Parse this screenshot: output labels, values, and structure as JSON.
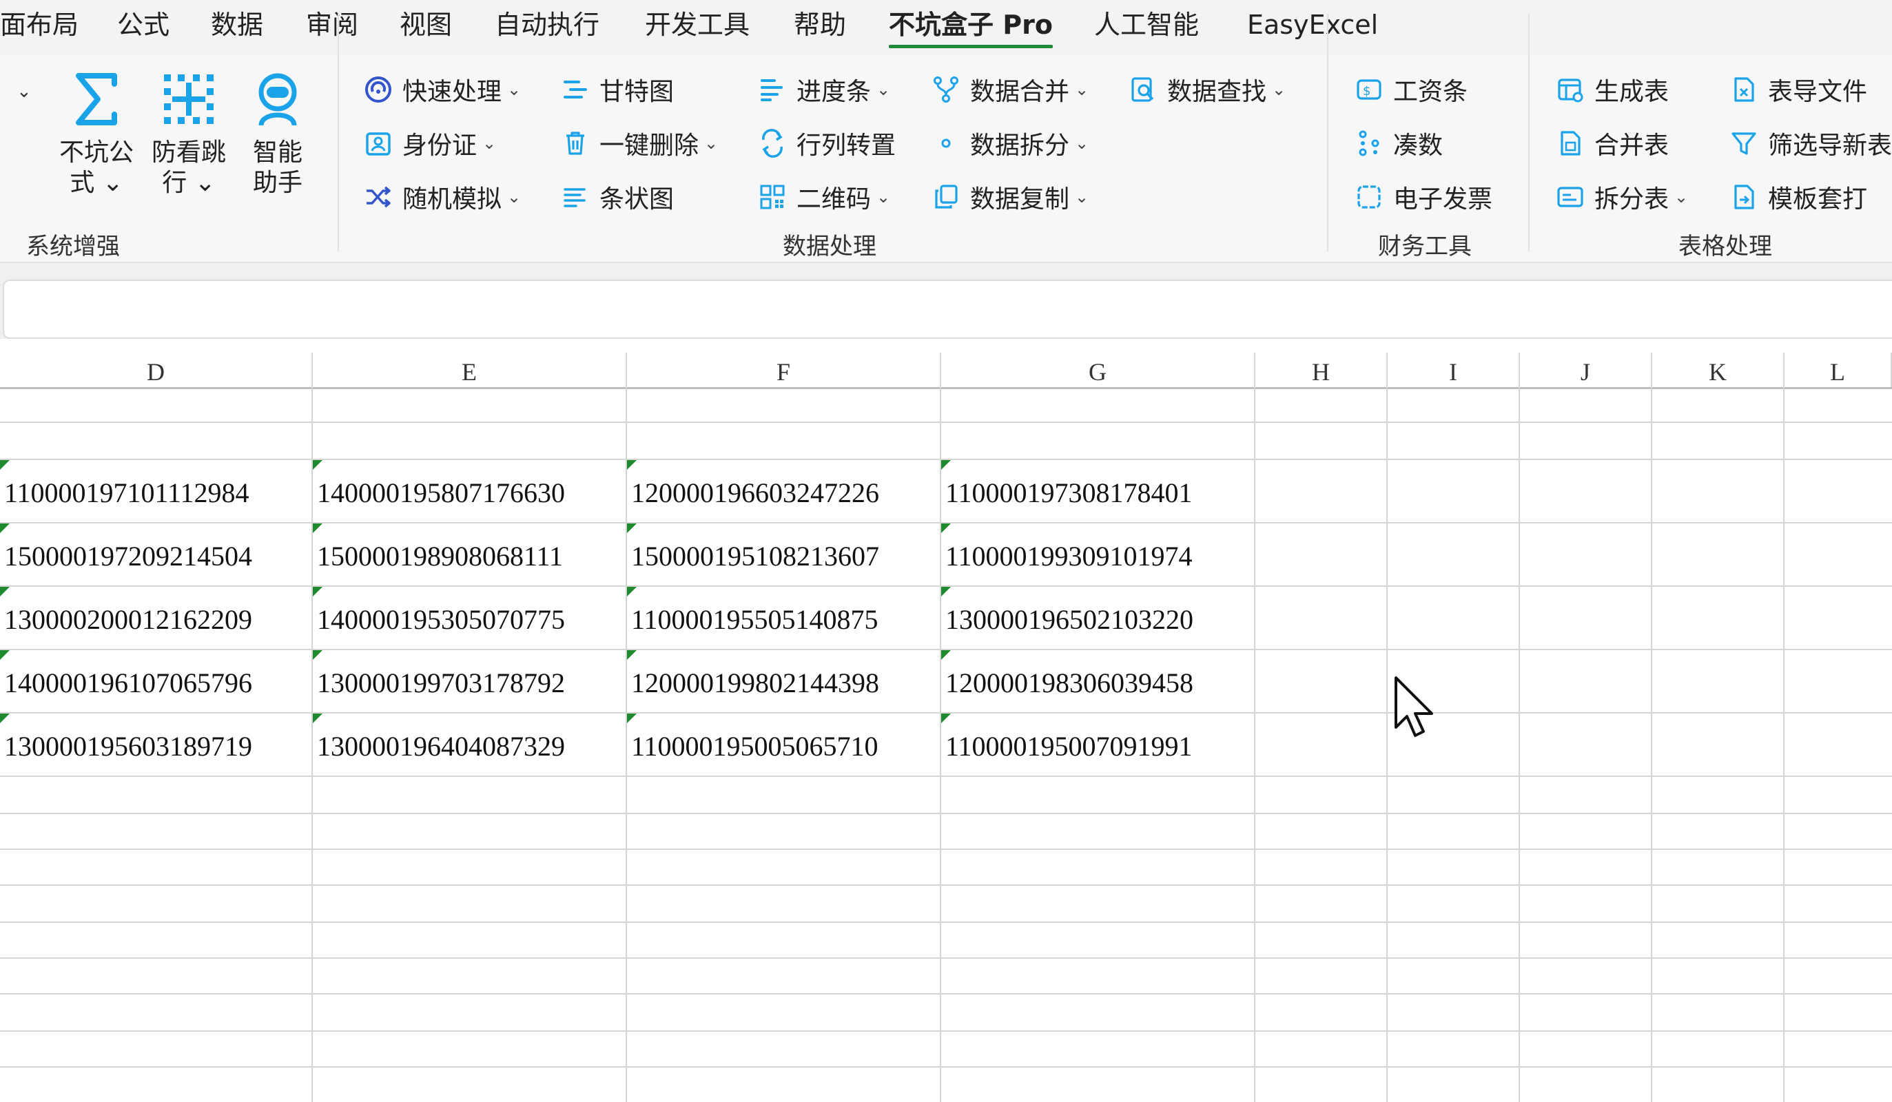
{
  "menu_tabs": [
    "面布局",
    "公式",
    "数据",
    "审阅",
    "视图",
    "自动执行",
    "开发工具",
    "帮助",
    "不坑盒子 Pro",
    "人工智能",
    "EasyExcel"
  ],
  "active_tab": "不坑盒子 Pro",
  "ribbon": {
    "system_group": {
      "label": "系统增强",
      "buttons": [
        {
          "label": "不坑公\n式 ⌄",
          "icon": "sigma-icon"
        },
        {
          "label": "防看跳\n行 ⌄",
          "icon": "crosshair-grid-icon"
        },
        {
          "label": "智能\n助手",
          "icon": "robot-assistant-icon"
        }
      ]
    },
    "data_group": {
      "label": "数据处理",
      "items": [
        {
          "label": "快速处理",
          "dropdown": true,
          "icon": "quick-process-icon"
        },
        {
          "label": "身份证",
          "dropdown": true,
          "icon": "id-card-icon"
        },
        {
          "label": "随机模拟",
          "dropdown": true,
          "icon": "shuffle-icon"
        },
        {
          "label": "甘特图",
          "dropdown": false,
          "icon": "gantt-icon"
        },
        {
          "label": "一键删除",
          "dropdown": true,
          "icon": "trash-icon"
        },
        {
          "label": "条状图",
          "dropdown": false,
          "icon": "bar-lines-icon"
        },
        {
          "label": "进度条",
          "dropdown": true,
          "icon": "progress-bar-icon"
        },
        {
          "label": "行列转置",
          "dropdown": false,
          "icon": "transpose-icon"
        },
        {
          "label": "二维码",
          "dropdown": true,
          "icon": "qrcode-icon"
        },
        {
          "label": "数据合并",
          "dropdown": true,
          "icon": "merge-icon"
        },
        {
          "label": "数据拆分",
          "dropdown": true,
          "icon": "split-dot-icon"
        },
        {
          "label": "数据复制",
          "dropdown": true,
          "icon": "copy-icon"
        },
        {
          "label": "数据查找",
          "dropdown": true,
          "icon": "search-doc-icon"
        }
      ]
    },
    "finance_group": {
      "label": "财务工具",
      "items": [
        {
          "label": "工资条",
          "icon": "salary-icon"
        },
        {
          "label": "凑数",
          "icon": "dots-icon"
        },
        {
          "label": "电子发票",
          "icon": "invoice-icon"
        }
      ]
    },
    "table_group": {
      "label": "表格处理",
      "items": [
        {
          "label": "生成表",
          "dropdown": false,
          "icon": "generate-table-icon"
        },
        {
          "label": "合并表",
          "dropdown": false,
          "icon": "merge-table-icon"
        },
        {
          "label": "拆分表",
          "dropdown": true,
          "icon": "split-table-icon"
        },
        {
          "label": "表导文件",
          "dropdown": false,
          "icon": "export-file-icon"
        },
        {
          "label": "筛选导新表",
          "dropdown": false,
          "icon": "filter-icon"
        },
        {
          "label": "模板套打",
          "dropdown": false,
          "icon": "template-print-icon"
        }
      ]
    }
  },
  "formula_bar": {
    "value": ""
  },
  "columns": [
    "D",
    "E",
    "F",
    "G",
    "H",
    "I",
    "J",
    "K",
    "L"
  ],
  "rows": [
    [
      "110000197101112984",
      "140000195807176630",
      "120000196603247226",
      "110000197308178401"
    ],
    [
      "150000197209214504",
      "150000198908068111",
      "150000195108213607",
      "110000199309101974"
    ],
    [
      "130000200012162209",
      "140000195305070775",
      "110000195505140875",
      "130000196502103220"
    ],
    [
      "140000196107065796",
      "130000199703178792",
      "120000199802144398",
      "120000198306039458"
    ],
    [
      "130000195603189719",
      "130000196404087329",
      "110000195005065710",
      "110000195007091991"
    ]
  ],
  "colors": {
    "accent": "#1f8a3a",
    "icon_blue": "#1aa3e8",
    "icon_navy": "#3355cc",
    "cell_marker": "#1e8a2e"
  }
}
